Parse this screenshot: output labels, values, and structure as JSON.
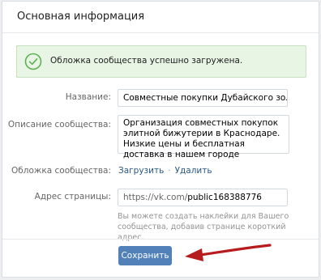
{
  "section": {
    "title": "Основная информация"
  },
  "notification": {
    "text": "Обложка сообщества успешно загружена.",
    "icon": "checkmark-circle-icon",
    "accent_color": "#5fb053"
  },
  "form": {
    "name": {
      "label": "Название:",
      "value": "Совместные покупки Дубайского золота"
    },
    "description": {
      "label": "Описание сообщества:",
      "value": "Организация совместных покупок элитной бижутерии в Краснодаре. Низкие цены и бесплатная доставка в нашем городе"
    },
    "cover": {
      "label": "Обложка сообщества:",
      "upload_link": "Загрузить",
      "separator": "·",
      "delete_link": "Удалить"
    },
    "address": {
      "label": "Адрес страницы:",
      "prefix": "https://vk.com/",
      "value": "public168388776",
      "hint": "Вы можете создать наклейки для Вашего сообщества, добавив странице короткий адрес."
    },
    "save_label": "Сохранить"
  },
  "colors": {
    "button": "#5181b8",
    "link": "#2a5885",
    "annotation_arrow": "#b71c1c"
  }
}
